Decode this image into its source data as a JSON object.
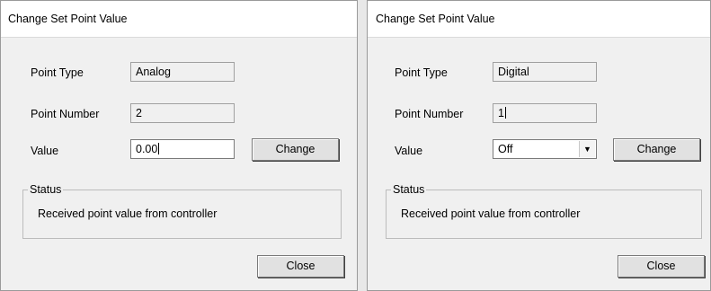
{
  "left_dialog": {
    "title": "Change Set Point Value",
    "point_type_label": "Point Type",
    "point_type_value": "Analog",
    "point_number_label": "Point Number",
    "point_number_value": "2",
    "value_label": "Value",
    "value_value": "0.00",
    "change_button": "Change",
    "status_label": "Status",
    "status_text": "Received point value from controller",
    "close_button": "Close"
  },
  "right_dialog": {
    "title": "Change Set Point Value",
    "point_type_label": "Point Type",
    "point_type_value": "Digital",
    "point_number_label": "Point Number",
    "point_number_value": "1",
    "value_label": "Value",
    "value_selected": "Off",
    "change_button": "Change",
    "status_label": "Status",
    "status_text": "Received point value from controller",
    "close_button": "Close"
  },
  "icons": {
    "dropdown": "chevron-down-icon"
  }
}
